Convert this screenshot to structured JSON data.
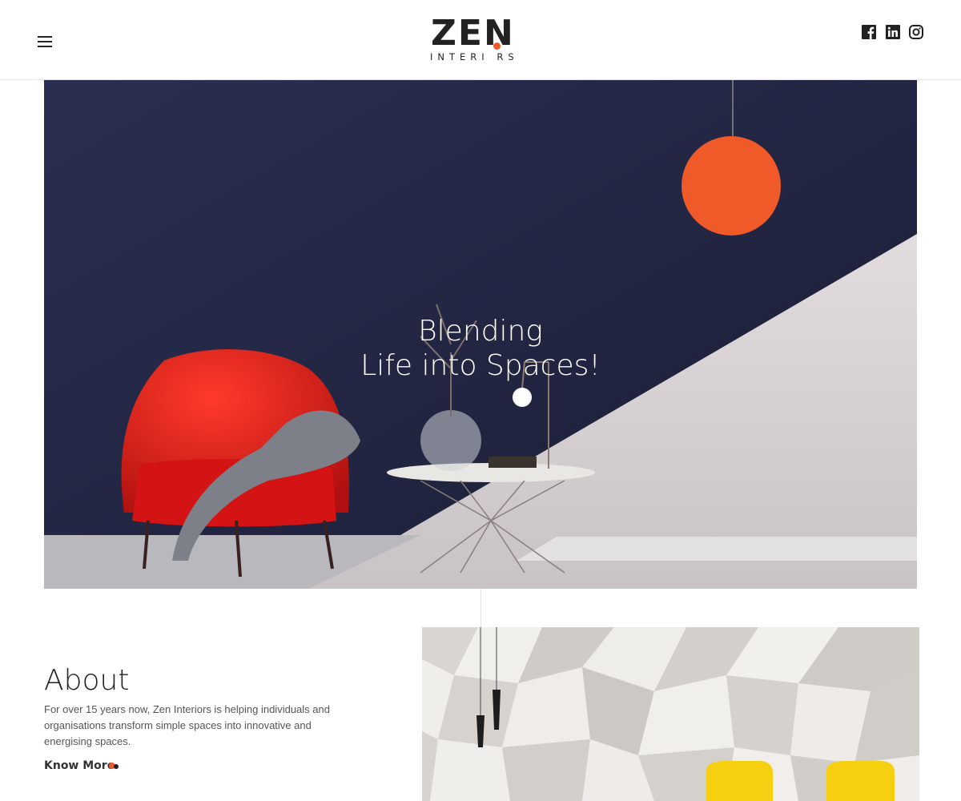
{
  "header": {
    "logo_main": "ZEN",
    "logo_sub": "INTERI RS",
    "menu_icon": "hamburger-menu-icon",
    "social": [
      {
        "name": "facebook-icon",
        "label": "f"
      },
      {
        "name": "linkedin-icon",
        "label": "in"
      },
      {
        "name": "instagram-icon",
        "label": ""
      }
    ]
  },
  "hero": {
    "title_line1": "Blending",
    "title_line2": "Life into Spaces!"
  },
  "about": {
    "heading": "About",
    "text": "For over 15 years now, Zen Interiors is helping individuals and organisations transform simple spaces into innovative and energising spaces.",
    "link_label": "Know More"
  },
  "colors": {
    "accent": "#f05a28",
    "hero_wall": "#1f2440",
    "text_dark": "#222222"
  }
}
